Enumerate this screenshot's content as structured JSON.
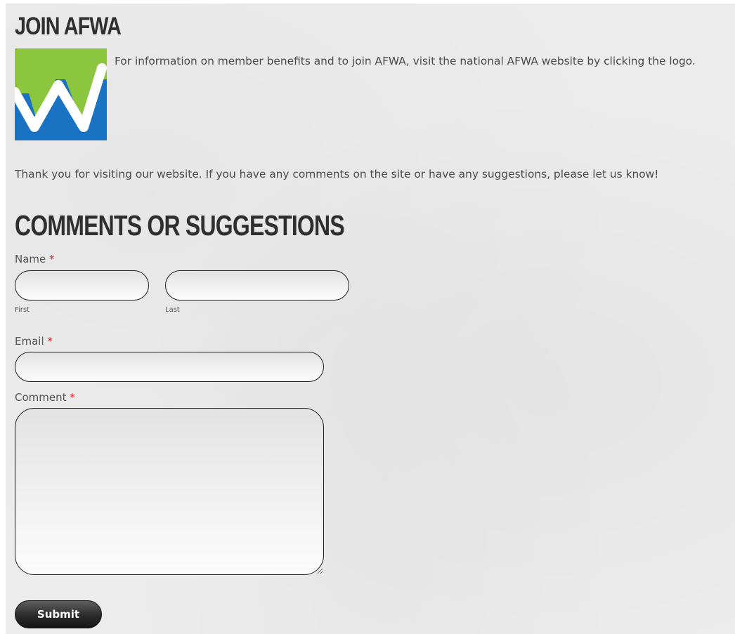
{
  "join": {
    "heading": "JOIN AFWA",
    "info_text": "For information on member benefits and to join AFWA, visit the national AFWA website by clicking the logo."
  },
  "intro_text": "Thank you for visiting our website.  If you have any comments on the site or have any suggestions, please let us know!",
  "form": {
    "heading": "COMMENTS OR SUGGESTIONS",
    "required_mark": "*",
    "name": {
      "label": "Name",
      "first_sublabel": "First",
      "last_sublabel": "Last",
      "first_value": "",
      "last_value": ""
    },
    "email": {
      "label": "Email",
      "value": ""
    },
    "comment": {
      "label": "Comment",
      "value": ""
    },
    "submit_label": "Submit"
  },
  "colors": {
    "logo_green": "#8cc63f",
    "logo_blue": "#1a73c2",
    "required": "#dd2222",
    "background": "#ececec"
  }
}
